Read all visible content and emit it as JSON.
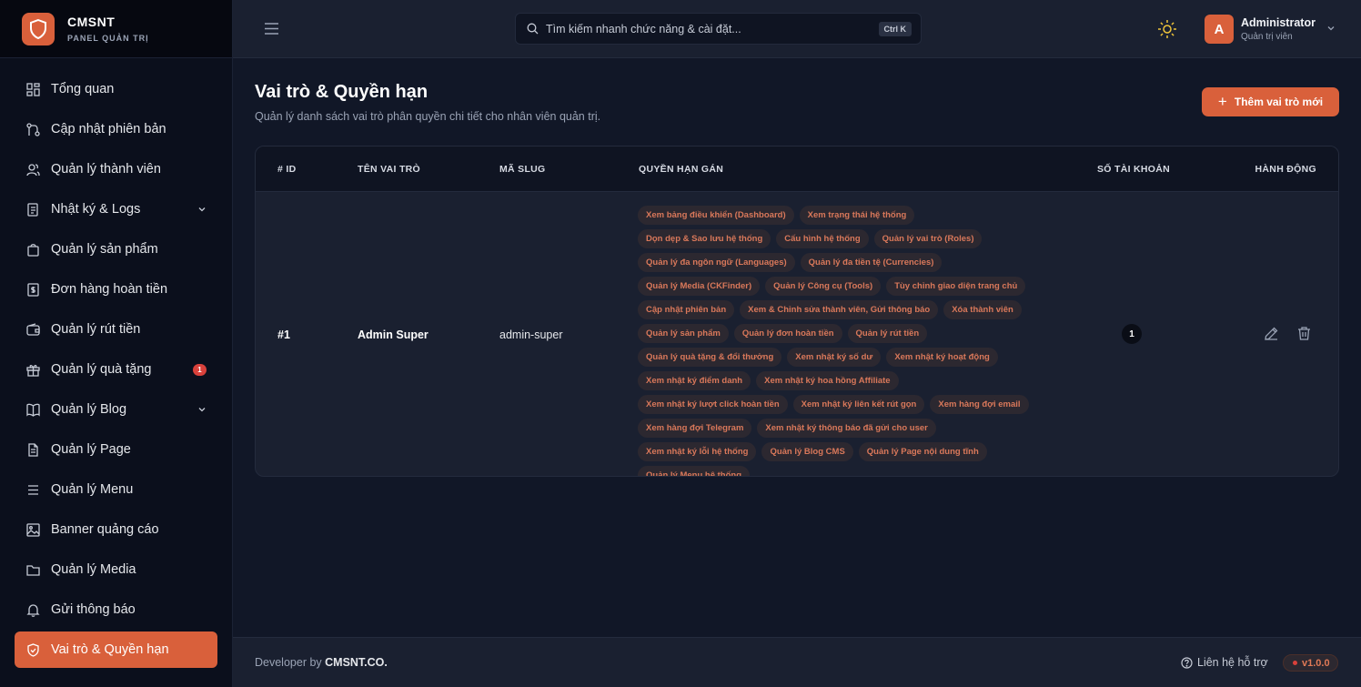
{
  "brand": {
    "name": "CMSNT",
    "subtitle": "PANEL QUẢN TRỊ"
  },
  "sidebar": {
    "items": [
      {
        "label": "Tổng quan",
        "icon": "dashboard-icon"
      },
      {
        "label": "Cập nhật phiên bản",
        "icon": "git-icon"
      },
      {
        "label": "Quản lý thành viên",
        "icon": "users-icon"
      },
      {
        "label": "Nhật ký & Logs",
        "icon": "logs-icon",
        "expandable": true
      },
      {
        "label": "Quản lý sản phẩm",
        "icon": "bag-icon"
      },
      {
        "label": "Đơn hàng hoàn tiền",
        "icon": "receipt-icon"
      },
      {
        "label": "Quản lý rút tiền",
        "icon": "wallet-icon"
      },
      {
        "label": "Quản lý quà tặng",
        "icon": "gift-icon",
        "badge": "1"
      },
      {
        "label": "Quản lý Blog",
        "icon": "book-icon",
        "expandable": true
      },
      {
        "label": "Quản lý Page",
        "icon": "page-icon"
      },
      {
        "label": "Quản lý Menu",
        "icon": "menu-icon"
      },
      {
        "label": "Banner quảng cáo",
        "icon": "image-icon"
      },
      {
        "label": "Quản lý Media",
        "icon": "folder-icon"
      },
      {
        "label": "Gửi thông báo",
        "icon": "bell-icon"
      },
      {
        "label": "Vai trò & Quyền hạn",
        "icon": "shield-icon",
        "active": true
      }
    ]
  },
  "header": {
    "search_placeholder": "Tìm kiếm nhanh chức năng & cài đặt...",
    "search_shortcut": "Ctrl K",
    "user_initial": "A",
    "user_name": "Administrator",
    "user_role": "Quản trị viên"
  },
  "main": {
    "title": "Vai trò & Quyền hạn",
    "subtitle": "Quản lý danh sách vai trò phân quyền chi tiết cho nhân viên quản trị.",
    "add_button": "Thêm vai trò mới",
    "table": {
      "columns": [
        "# ID",
        "TÊN VAI TRÒ",
        "MÃ SLUG",
        "QUYỀN HẠN GÁN",
        "SỐ TÀI KHOẢN",
        "HÀNH ĐỘNG"
      ],
      "rows": [
        {
          "id": "#1",
          "name": "Admin Super",
          "slug": "admin-super",
          "accounts": "1",
          "permissions": [
            "Xem bảng điều khiển (Dashboard)",
            "Xem trạng thái hệ thống",
            "Dọn dẹp & Sao lưu hệ thống",
            "Cấu hình hệ thống",
            "Quản lý vai trò (Roles)",
            "Quản lý đa ngôn ngữ (Languages)",
            "Quản lý đa tiền tệ (Currencies)",
            "Quản lý Media (CKFinder)",
            "Quản lý Công cụ (Tools)",
            "Tùy chỉnh giao diện trang chủ",
            "Cập nhật phiên bản",
            "Xem & Chỉnh sửa thành viên, Gửi thông báo",
            "Xóa thành viên",
            "Quản lý sản phẩm",
            "Quản lý đơn hoàn tiền",
            "Quản lý rút tiền",
            "Quản lý quà tặng & đổi thưởng",
            "Xem nhật ký số dư",
            "Xem nhật ký hoạt động",
            "Xem nhật ký điểm danh",
            "Xem nhật ký hoa hồng Affiliate",
            "Xem nhật ký lượt click hoàn tiền",
            "Xem nhật ký liên kết rút gọn",
            "Xem hàng đợi email",
            "Xem hàng đợi Telegram",
            "Xem nhật ký thông báo đã gửi cho user",
            "Xem nhật ký lỗi hệ thống",
            "Quản lý Blog CMS",
            "Quản lý Page nội dung tĩnh",
            "Quản lý Menu hệ thống"
          ]
        }
      ]
    }
  },
  "footer": {
    "developer_prefix": "Developer by ",
    "developer_name": "CMSNT.CO.",
    "support": "Liên hệ hỗ trợ",
    "version": "v1.0.0"
  },
  "colors": {
    "accent": "#d9603b",
    "background": "#111727",
    "sidebar": "#0b0f1c"
  }
}
